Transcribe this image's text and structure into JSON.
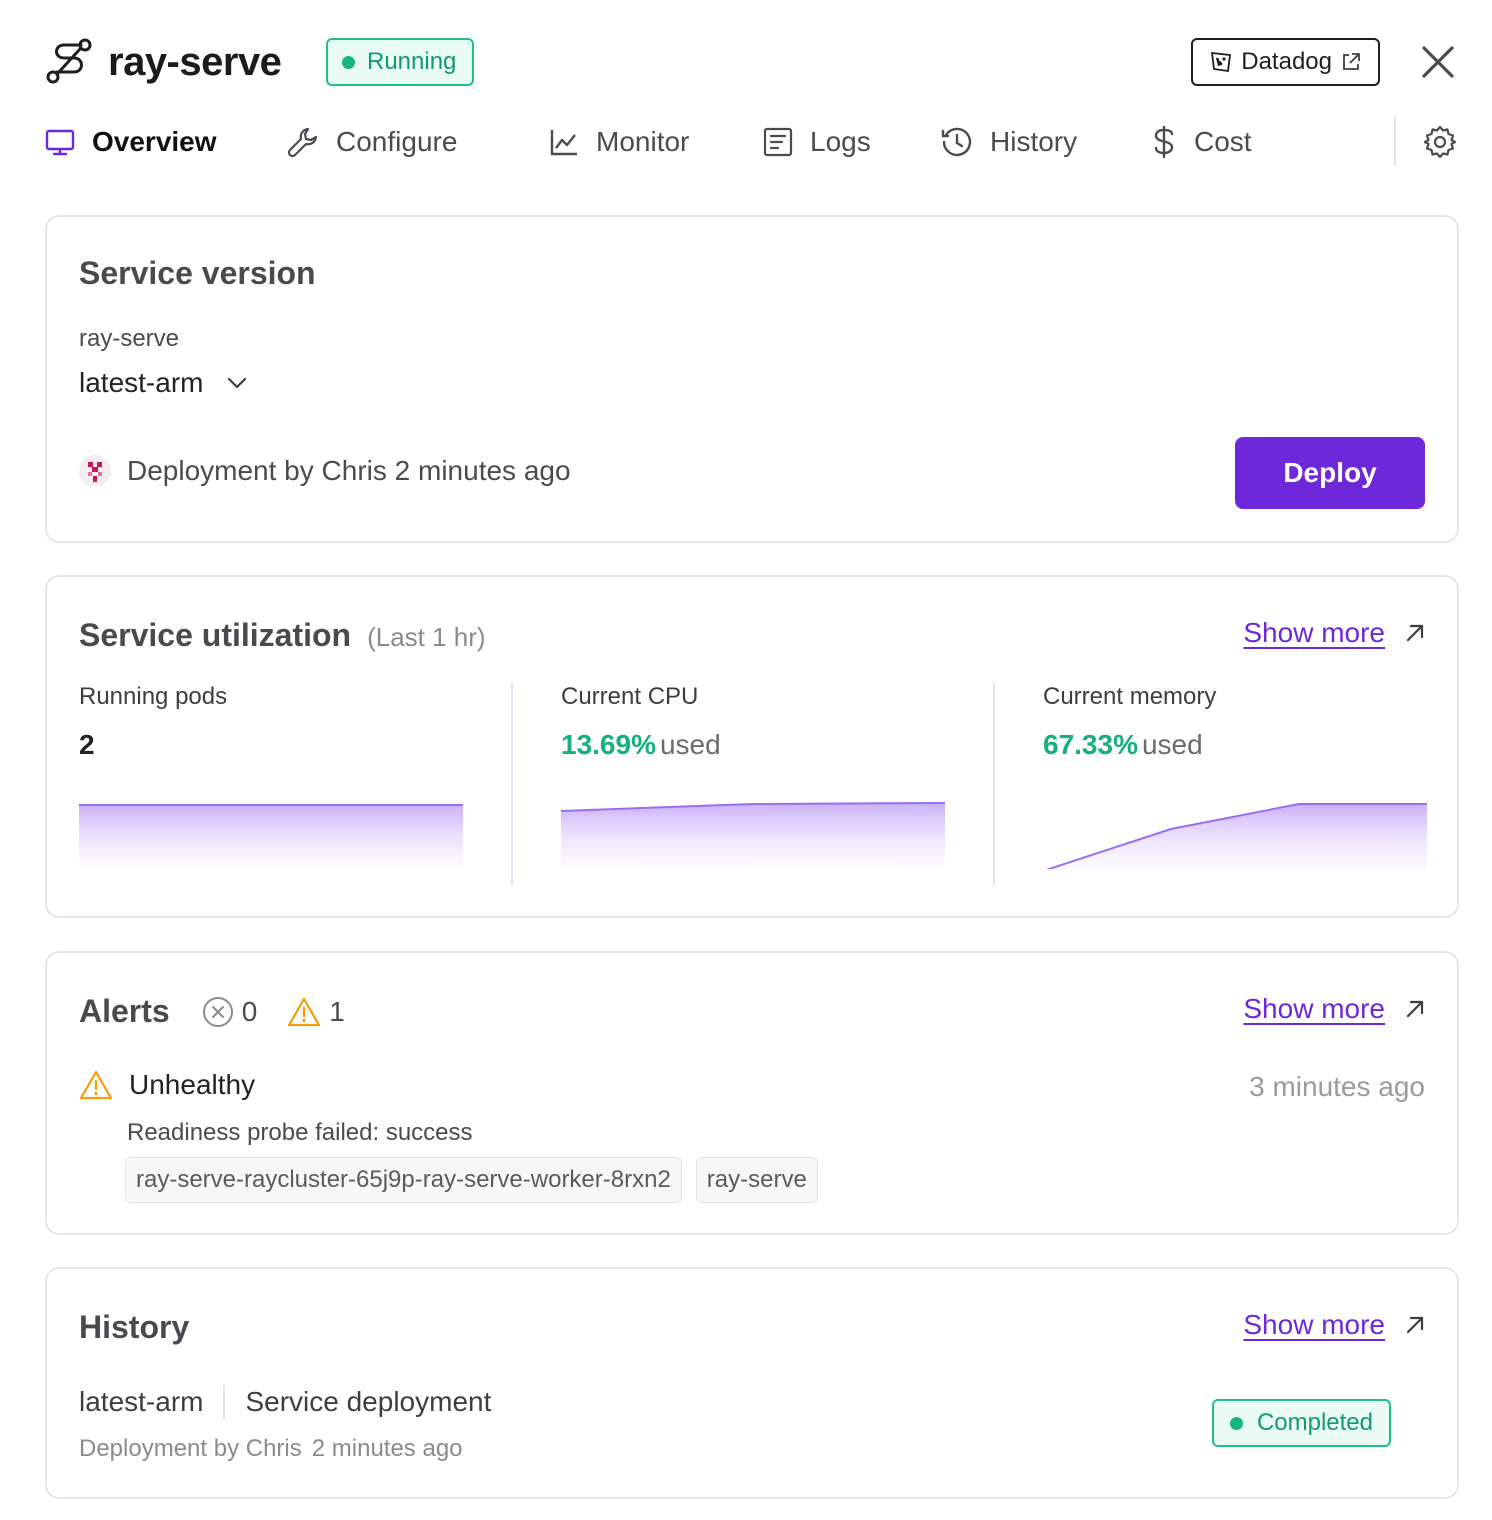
{
  "header": {
    "title": "ray-serve",
    "status": "Running",
    "datadog_label": "Datadog"
  },
  "tabs": [
    {
      "label": "Overview",
      "active": true,
      "icon": "monitor-icon"
    },
    {
      "label": "Configure",
      "active": false,
      "icon": "wrench-icon"
    },
    {
      "label": "Monitor",
      "active": false,
      "icon": "line-chart-icon"
    },
    {
      "label": "Logs",
      "active": false,
      "icon": "logs-icon"
    },
    {
      "label": "History",
      "active": false,
      "icon": "history-icon"
    },
    {
      "label": "Cost",
      "active": false,
      "icon": "dollar-icon"
    }
  ],
  "service_version": {
    "title": "Service version",
    "label": "ray-serve",
    "selected": "latest-arm",
    "deploy_info": "Deployment by Chris 2 minutes ago",
    "deploy_button": "Deploy"
  },
  "utilization": {
    "title": "Service utilization",
    "subtitle": "(Last 1 hr)",
    "show_more": "Show more",
    "used_label": "used",
    "metrics": [
      {
        "label": "Running pods",
        "value": "2"
      },
      {
        "label": "Current CPU",
        "value": "13.69%"
      },
      {
        "label": "Current memory",
        "value": "67.33%"
      }
    ]
  },
  "alerts": {
    "title": "Alerts",
    "error_count": "0",
    "warning_count": "1",
    "show_more": "Show more",
    "item": {
      "title": "Unhealthy",
      "time": "3 minutes ago",
      "description": "Readiness probe failed: success",
      "tags": [
        "ray-serve-raycluster-65j9p-ray-serve-worker-8rxn2",
        "ray-serve"
      ]
    }
  },
  "history": {
    "title": "History",
    "show_more": "Show more",
    "item": {
      "version": "latest-arm",
      "type": "Service deployment",
      "by": "Deployment by Chris",
      "time": "2 minutes ago",
      "status": "Completed"
    }
  },
  "colors": {
    "accent": "#6d28d9",
    "success": "#14b07d",
    "warning": "#f59e0b"
  }
}
